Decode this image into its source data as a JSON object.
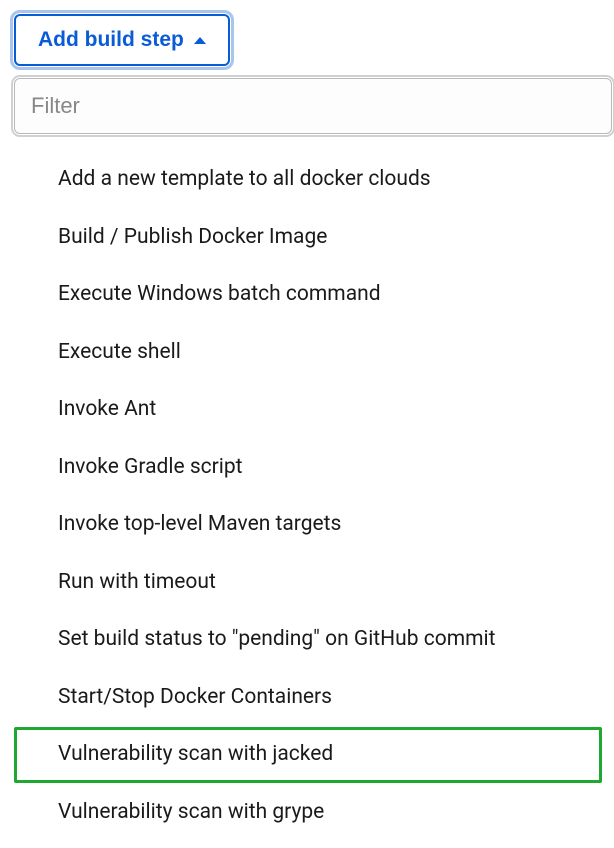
{
  "button": {
    "label": "Add build step"
  },
  "filter": {
    "placeholder": "Filter"
  },
  "menu": {
    "items": [
      {
        "label": "Add a new template to all docker clouds",
        "highlighted": false
      },
      {
        "label": "Build / Publish Docker Image",
        "highlighted": false
      },
      {
        "label": "Execute Windows batch command",
        "highlighted": false
      },
      {
        "label": "Execute shell",
        "highlighted": false
      },
      {
        "label": "Invoke Ant",
        "highlighted": false
      },
      {
        "label": "Invoke Gradle script",
        "highlighted": false
      },
      {
        "label": "Invoke top-level Maven targets",
        "highlighted": false
      },
      {
        "label": "Run with timeout",
        "highlighted": false
      },
      {
        "label": "Set build status to \"pending\" on GitHub commit",
        "highlighted": false
      },
      {
        "label": "Start/Stop Docker Containers",
        "highlighted": false
      },
      {
        "label": "Vulnerability scan with jacked",
        "highlighted": true
      },
      {
        "label": "Vulnerability scan with grype",
        "highlighted": false
      }
    ]
  }
}
